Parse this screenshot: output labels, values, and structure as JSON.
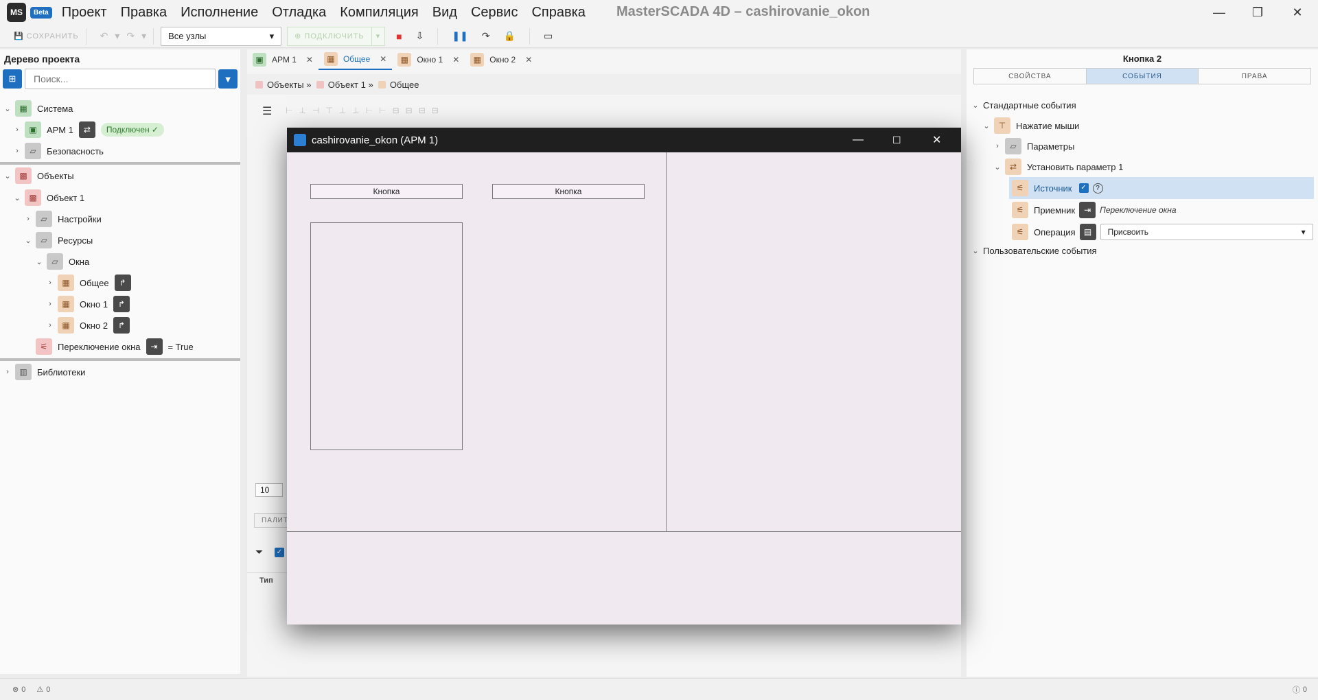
{
  "app": {
    "logo": "MS",
    "beta": "Beta",
    "title": "MasterSCADA 4D – cashirovanie_okon",
    "menu": [
      "Проект",
      "Правка",
      "Исполнение",
      "Отладка",
      "Компиляция",
      "Вид",
      "Сервис",
      "Справка"
    ]
  },
  "toolbar": {
    "save_label": "СОХРАНИТЬ",
    "nodes_select": "Все узлы",
    "connect_label": "ПОДКЛЮЧИТЬ"
  },
  "left_panel": {
    "title": "Дерево проекта",
    "search_placeholder": "Поиск...",
    "tree": {
      "system": "Система",
      "arm1": "АРМ 1",
      "connected": "Подключен",
      "security": "Безопасность",
      "objects": "Объекты",
      "object1": "Объект 1",
      "settings": "Настройки",
      "resources": "Ресурсы",
      "windows": "Окна",
      "general": "Общее",
      "window1": "Окно 1",
      "window2": "Окно 2",
      "switch": "Переключение окна",
      "switch_value": "= True",
      "libraries": "Библиотеки"
    }
  },
  "editor": {
    "tabs": [
      "АРМ 1",
      "Общее",
      "Окно 1",
      "Окно 2"
    ],
    "breadcrumb": [
      "Объекты",
      "Объект 1",
      "Общее"
    ],
    "zoom": "10",
    "palette_label": "ПАЛИТ",
    "type_col": "Тип"
  },
  "runtime_window": {
    "title": "cashirovanie_okon (АРМ 1)",
    "button1": "Кнопка",
    "button2": "Кнопка"
  },
  "right_panel": {
    "title": "Кнопка 2",
    "tabs": [
      "СВОЙСТВА",
      "СОБЫТИЯ",
      "ПРАВА"
    ],
    "standard_events": "Стандартные события",
    "mouse_click": "Нажатие мыши",
    "params": "Параметры",
    "set_param": "Установить параметр 1",
    "source": "Источник",
    "receiver": "Приемник",
    "receiver_value": "Переключение окна",
    "operation": "Операция",
    "operation_value": "Присвоить",
    "user_events": "Пользовательские события"
  },
  "status": {
    "errors": "0",
    "warnings": "0",
    "info": "0"
  }
}
